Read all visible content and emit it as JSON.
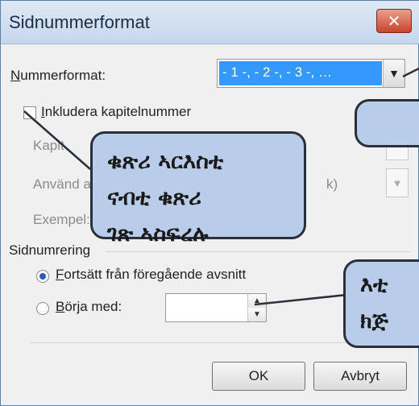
{
  "dialog": {
    "title": "Sidnummerformat",
    "close_label": "✕"
  },
  "number_format": {
    "label_prefix": "N",
    "label_rest": "ummerformat:",
    "value": "- 1 -, - 2 -, - 3 -, …"
  },
  "chapter": {
    "include_prefix": "I",
    "include_rest": "nkludera kapitelnummer",
    "chapter_style_label": "Kapit",
    "use_separator_label": "Använd a",
    "separator_fragment": "k)",
    "example_label": "Exempel:"
  },
  "numbering": {
    "section_label": "Sidnumrering",
    "continue_prefix": "F",
    "continue_rest": "ortsätt från föregående avsnitt",
    "start_prefix": "B",
    "start_rest": "örja med:",
    "start_value": ""
  },
  "buttons": {
    "ok": "OK",
    "cancel": "Avbryt"
  },
  "callouts": {
    "chapter_lines": [
      "ቁጽሪ ኣርእስቲ",
      "ናብቲ ቁጽሪ",
      "ገጽ ኣስፍረሉ"
    ],
    "top_right": "",
    "bottom_right_lines": [
      "እቲ",
      "ክጅ"
    ]
  }
}
